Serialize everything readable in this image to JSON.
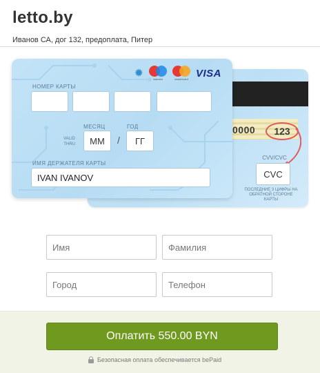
{
  "header": {
    "shop_title": "letto.by",
    "order_description": "Иванов СА, дог 132, предоплата, Питер"
  },
  "card_front": {
    "number_label": "НОМЕР КАРТЫ",
    "month_label": "МЕСЯЦ",
    "year_label": "ГОД",
    "valid_thru_line1": "VALID",
    "valid_thru_line2": "THRU",
    "month_placeholder": "ММ",
    "year_placeholder": "ГГ",
    "date_separator": "/",
    "holder_label": "ИМЯ ДЕРЖАТЕЛЯ КАРТЫ",
    "holder_value": "IVAN IVANOV",
    "logos": {
      "gear_icon": "gear-icon",
      "maestro_caption": "maestro",
      "mastercard_caption": "mastercard",
      "visa_text": "VISA"
    }
  },
  "card_back": {
    "signature_digits": "0000",
    "cvv_example": "123",
    "cvv_label": "CVV/CVC",
    "cvc_placeholder": "CVC",
    "cvv_hint": "ПОСЛЕДНИЕ 3 ЦИФРЫ НА ОБРАТНОЙ СТОРОНЕ КАРТЫ"
  },
  "form": {
    "first_name_placeholder": "Имя",
    "last_name_placeholder": "Фамилия",
    "city_placeholder": "Город",
    "phone_placeholder": "Телефон"
  },
  "footer": {
    "pay_button_label": "Оплатить 550.00 BYN",
    "secure_text": "Безопасная оплата обеспечивается bePaid"
  },
  "colors": {
    "pay_button": "#6f9a1f",
    "card_bg": "#c3e3f7",
    "footer_bg": "#f0f3e6",
    "cvv_highlight": "#e05a5a"
  }
}
